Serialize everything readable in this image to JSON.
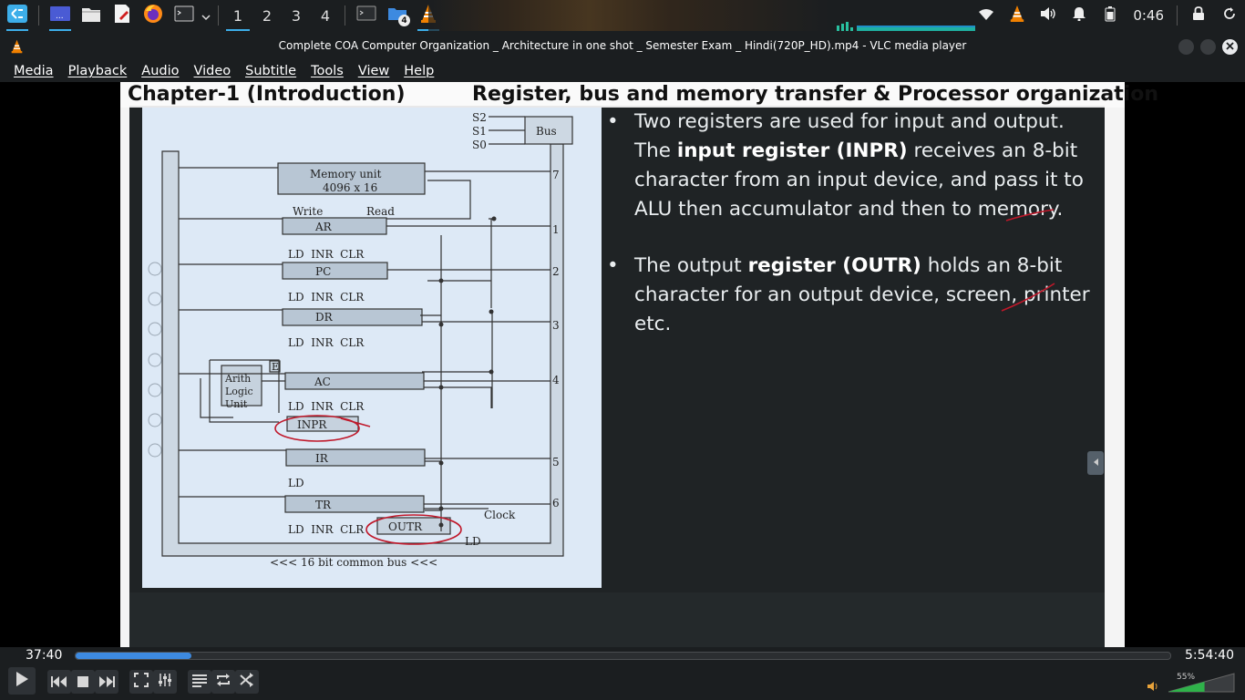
{
  "taskbar": {
    "apps": [
      {
        "name": "kde-launcher-icon"
      },
      {
        "name": "desktop-pager-icon"
      },
      {
        "name": "file-manager-icon"
      },
      {
        "name": "text-editor-icon"
      },
      {
        "name": "firefox-icon"
      },
      {
        "name": "terminal-icon"
      }
    ],
    "workspaces": [
      "1",
      "2",
      "3",
      "4"
    ],
    "window_badge": "4",
    "clock": "0:46"
  },
  "window": {
    "title": "Complete COA Computer Organization _ Architecture in one shot _ Semester Exam _ Hindi(720P_HD).mp4 - VLC media player"
  },
  "menu": [
    "Media",
    "Playback",
    "Audio",
    "Video",
    "Subtitle",
    "Tools",
    "View",
    "Help"
  ],
  "video": {
    "heading_left": "Chapter-1 (Introduction)",
    "heading_right": "Register, bus and memory transfer & Processor organization",
    "diagram": {
      "selects": [
        "S2",
        "S1",
        "S0"
      ],
      "bus": "Bus",
      "memory_unit": "Memory unit",
      "memory_size": "4096 x 16",
      "write": "Write",
      "read": "Read",
      "ar": "AR",
      "pc": "PC",
      "dr": "DR",
      "ac": "AC",
      "inpr": "INPR",
      "ir": "IR",
      "tr": "TR",
      "outr": "OUTR",
      "e": "E",
      "alu1": "Arith",
      "alu2": "Logic",
      "alu3": "Unit",
      "ld_inr_clr": "LD  INR  CLR",
      "ld": "LD",
      "clock": "Clock",
      "bus_label": "<<< 16 bit common bus <<<",
      "bus_numbers": [
        "7",
        "1",
        "2",
        "3",
        "4",
        "5",
        "6"
      ]
    },
    "bullet1": {
      "p1": "Two registers are used for input and output. The ",
      "b1": "input register (INPR)",
      "p2": " receives an 8-bit character from an input device, and pass it to ALU then accumulator and then to memory."
    },
    "bullet2": {
      "p1": "The output ",
      "b1": "register (OUTR)",
      "p2": " holds an 8-bit character for an output device, screen, printer etc."
    }
  },
  "player": {
    "current_time": "37:40",
    "total_time": "5:54:40",
    "progress": 0.106,
    "volume": "55%",
    "volume_level": 0.55
  },
  "colors": {
    "accent": "#3daee9",
    "seek_fill": "#3d8ae0",
    "vlc_orange": "#f08000",
    "annotation_red": "#c0182a"
  }
}
